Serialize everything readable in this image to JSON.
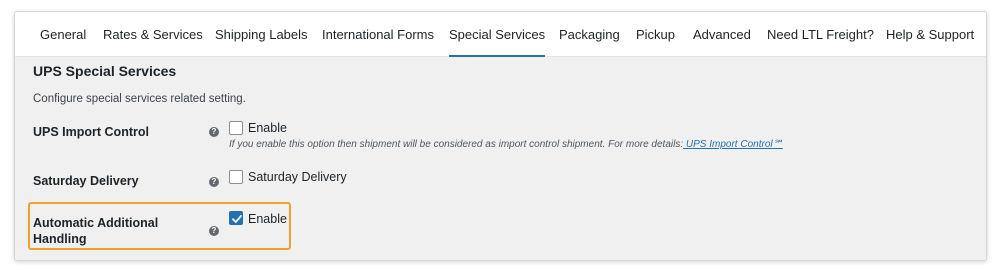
{
  "tabs": [
    {
      "label": "General"
    },
    {
      "label": "Rates & Services"
    },
    {
      "label": "Shipping Labels"
    },
    {
      "label": "International Forms"
    },
    {
      "label": "Special Services",
      "active": true
    },
    {
      "label": "Packaging"
    },
    {
      "label": "Pickup"
    },
    {
      "label": "Advanced"
    },
    {
      "label": "Need LTL Freight?"
    },
    {
      "label": "Help & Support"
    }
  ],
  "section": {
    "title": "UPS Special Services",
    "description": "Configure special services related setting."
  },
  "settings": {
    "import_control": {
      "label": "UPS Import Control",
      "checkbox_label": "Enable",
      "checked": false,
      "hint_text": "If you enable this option then shipment will be considered as import control shipment. For more details:",
      "hint_link": " UPS Import Control℠"
    },
    "saturday_delivery": {
      "label": "Saturday Delivery",
      "checkbox_label": "Saturday Delivery",
      "checked": false
    },
    "additional_handling": {
      "label_line1": "Automatic Additional",
      "label_line2": "Handling",
      "checkbox_label": "Enable",
      "checked": true
    }
  },
  "help_glyph": "?",
  "colors": {
    "accent": "#2271b1",
    "highlight": "#f0a030",
    "panel_bg": "#f0f0f1"
  }
}
